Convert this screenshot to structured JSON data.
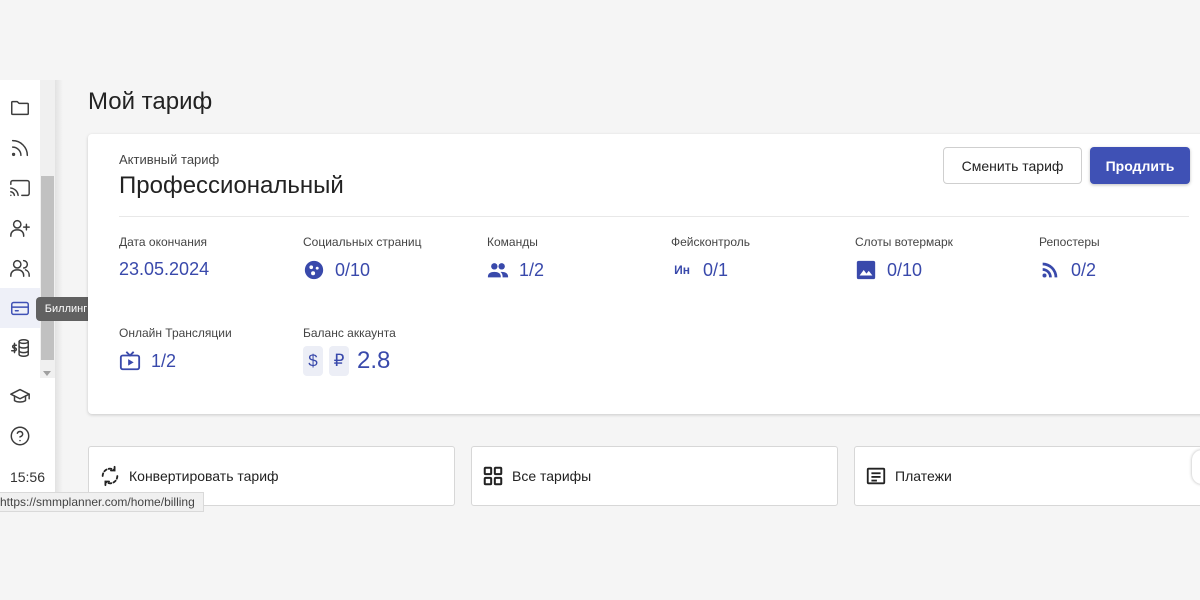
{
  "sidebar": {
    "items": [
      {
        "icon": "folder-icon",
        "name": "sidebar-item-folders"
      },
      {
        "icon": "rss-icon",
        "name": "sidebar-item-feeds"
      },
      {
        "icon": "cast-icon",
        "name": "sidebar-item-broadcast"
      },
      {
        "icon": "user-plus-icon",
        "name": "sidebar-item-add-user"
      },
      {
        "icon": "users-icon",
        "name": "sidebar-item-users"
      },
      {
        "icon": "credit-card-icon",
        "name": "sidebar-item-billing"
      },
      {
        "icon": "dollar-database-icon",
        "name": "sidebar-item-finance"
      },
      {
        "icon": "graduation-cap-icon",
        "name": "sidebar-item-education"
      },
      {
        "icon": "help-circle-icon",
        "name": "sidebar-item-help"
      }
    ],
    "tooltip": "Биллинг",
    "clock": "15:56"
  },
  "page": {
    "title": "Мой тариф"
  },
  "card": {
    "active_label": "Активный тариф",
    "tariff_name": "Профессиональный",
    "change_button": "Сменить тариф",
    "extend_button": "Продлить",
    "stats": {
      "end_date": {
        "label": "Дата окончания",
        "value": "23.05.2024"
      },
      "social_pages": {
        "label": "Социальных страниц",
        "value": "0/10",
        "icon": "social-icon"
      },
      "teams": {
        "label": "Команды",
        "value": "1/2",
        "icon": "people-icon"
      },
      "face_control": {
        "label": "Фейсконтроль",
        "value": "0/1",
        "icon_text": "Ин"
      },
      "watermark_slots": {
        "label": "Слоты вотермарк",
        "value": "0/10",
        "icon": "image-icon"
      },
      "reposters": {
        "label": "Репостеры",
        "value": "0/2",
        "icon": "rss-icon"
      },
      "online_streams": {
        "label": "Онлайн Трансляции",
        "value": "1/2",
        "icon": "tv-icon"
      },
      "balance": {
        "label": "Баланс аккаунта",
        "currency_usd": "$",
        "currency_rub": "₽",
        "value": "2.8"
      }
    }
  },
  "actions": {
    "convert": "Конвертировать тариф",
    "all_tariffs": "Все тарифы",
    "payments": "Платежи"
  },
  "status_bar": {
    "url": "https://smmplanner.com/home/billing"
  },
  "colors": {
    "accent": "#3f51b5",
    "value_text": "#3949ab",
    "background": "#f5f5f5"
  }
}
